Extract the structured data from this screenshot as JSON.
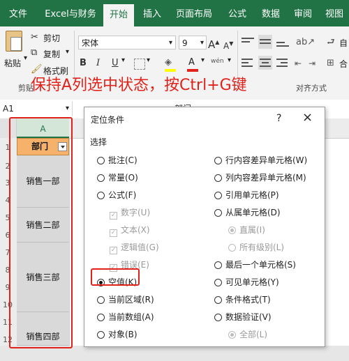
{
  "tabs": [
    "文件",
    "Excel与财务",
    "开始",
    "插入",
    "页面布局",
    "公式",
    "数据",
    "审阅",
    "视图"
  ],
  "active_tab": "开始",
  "ribbon": {
    "cut": "剪切",
    "copy": "复制",
    "paste": "粘贴",
    "format_painter": "格式刷",
    "clipboard_group": "剪贴",
    "font_name": "宋体",
    "font_size": "9",
    "bold": "B",
    "italic": "I",
    "underline": "U",
    "font_color_glyph": "A",
    "text_size_glyph": "wén",
    "wrap_label_partial": "自",
    "merge_label_partial": "合",
    "alignment_group": "对齐方式"
  },
  "annotation": "保持A列选中状态，按Ctrl+G键",
  "formula_bar": {
    "name_box": "A1",
    "formula_value": "部门"
  },
  "grid": {
    "column_a": "A",
    "row_numbers": [
      "1",
      "2",
      "3",
      "4",
      "5",
      "6",
      "7",
      "8",
      "9",
      "10",
      "11",
      "12"
    ],
    "header_cell": "部门",
    "cells": [
      "销售一部",
      "销售二部",
      "销售三部",
      "销售四部"
    ]
  },
  "dialog": {
    "title": "定位条件",
    "help": "?",
    "close": "×",
    "section": "选择",
    "left_options": [
      {
        "label": "批注(C)",
        "type": "radio",
        "disabled": false
      },
      {
        "label": "常量(O)",
        "type": "radio",
        "disabled": false
      },
      {
        "label": "公式(F)",
        "type": "radio",
        "disabled": false
      },
      {
        "label": "数字(U)",
        "type": "check",
        "disabled": true
      },
      {
        "label": "文本(X)",
        "type": "check",
        "disabled": true
      },
      {
        "label": "逻辑值(G)",
        "type": "check",
        "disabled": true
      },
      {
        "label": "错误(E)",
        "type": "check",
        "disabled": true
      },
      {
        "label": "空值(K)",
        "type": "radio",
        "disabled": false,
        "selected": true
      },
      {
        "label": "当前区域(R)",
        "type": "radio",
        "disabled": false
      },
      {
        "label": "当前数组(A)",
        "type": "radio",
        "disabled": false
      },
      {
        "label": "对象(B)",
        "type": "radio",
        "disabled": false
      }
    ],
    "right_options": [
      {
        "label": "行内容差异单元格(W)",
        "type": "radio",
        "disabled": false
      },
      {
        "label": "列内容差异单元格(M)",
        "type": "radio",
        "disabled": false
      },
      {
        "label": "引用单元格(P)",
        "type": "radio",
        "disabled": false
      },
      {
        "label": "从属单元格(D)",
        "type": "radio",
        "disabled": false
      },
      {
        "label": "直属(I)",
        "type": "radio",
        "disabled": true,
        "selected": true
      },
      {
        "label": "所有级别(L)",
        "type": "radio",
        "disabled": true
      },
      {
        "label": "最后一个单元格(S)",
        "type": "radio",
        "disabled": false
      },
      {
        "label": "可见单元格(Y)",
        "type": "radio",
        "disabled": false
      },
      {
        "label": "条件格式(T)",
        "type": "radio",
        "disabled": false
      },
      {
        "label": "数据验证(V)",
        "type": "radio",
        "disabled": false
      },
      {
        "label": "全部(L)",
        "type": "radio",
        "disabled": true,
        "selected": true
      }
    ]
  },
  "colors": {
    "excel_green": "#217346",
    "annotation_red": "#e0221b",
    "header_orange": "#f6b26b"
  }
}
